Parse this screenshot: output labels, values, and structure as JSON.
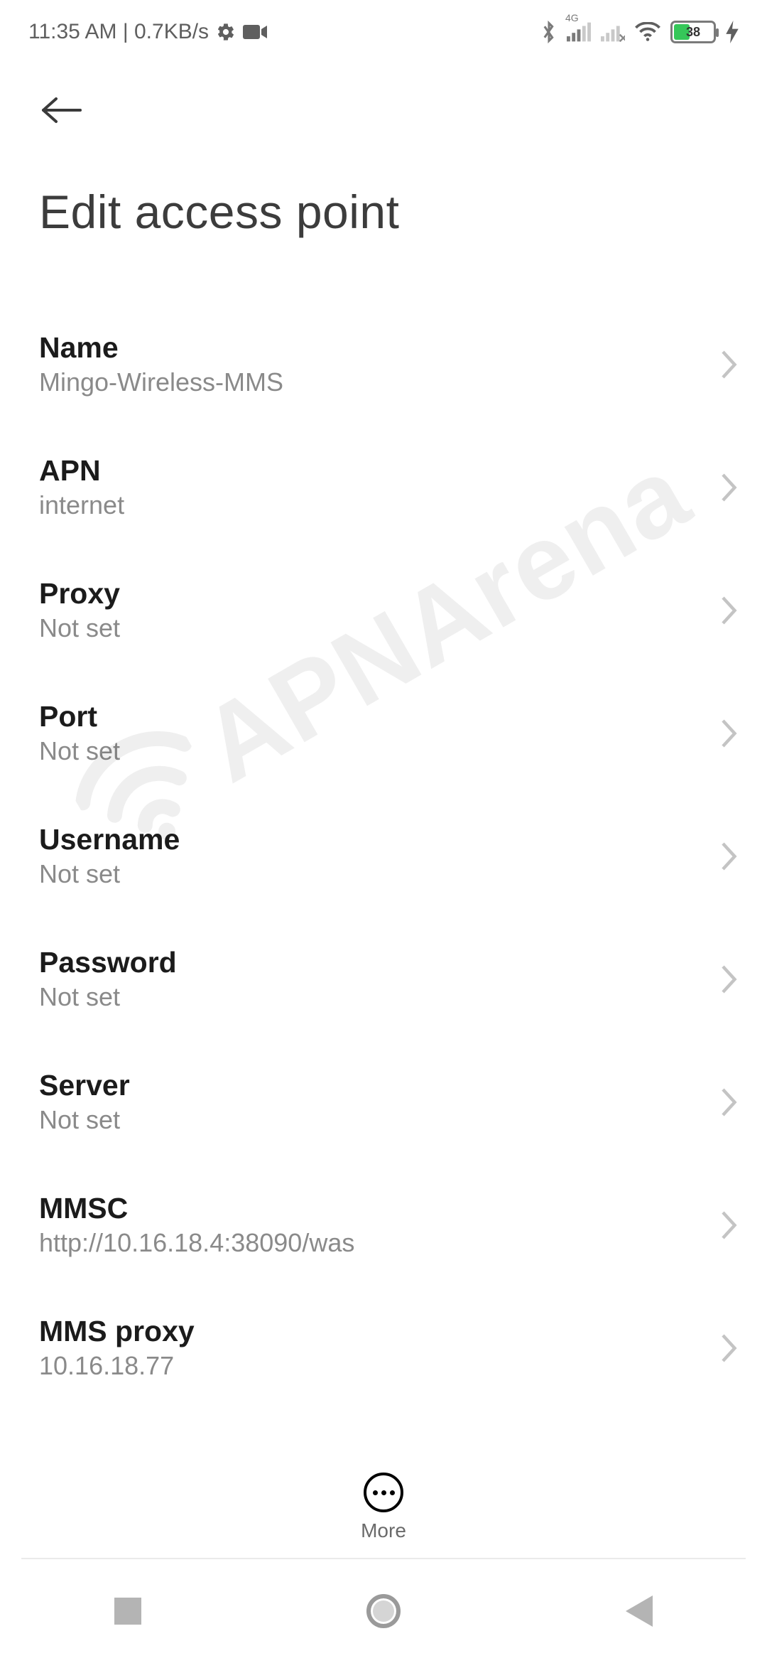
{
  "status_bar": {
    "time_text": "11:35 AM | 0.7KB/s",
    "network_badge": "4G",
    "battery_percent": "38"
  },
  "header": {
    "title": "Edit access point"
  },
  "items": [
    {
      "label": "Name",
      "value": "Mingo-Wireless-MMS"
    },
    {
      "label": "APN",
      "value": "internet"
    },
    {
      "label": "Proxy",
      "value": "Not set"
    },
    {
      "label": "Port",
      "value": "Not set"
    },
    {
      "label": "Username",
      "value": "Not set"
    },
    {
      "label": "Password",
      "value": "Not set"
    },
    {
      "label": "Server",
      "value": "Not set"
    },
    {
      "label": "MMSC",
      "value": "http://10.16.18.4:38090/was"
    },
    {
      "label": "MMS proxy",
      "value": "10.16.18.77"
    }
  ],
  "bottom": {
    "more_label": "More"
  },
  "watermark": "APNArena"
}
